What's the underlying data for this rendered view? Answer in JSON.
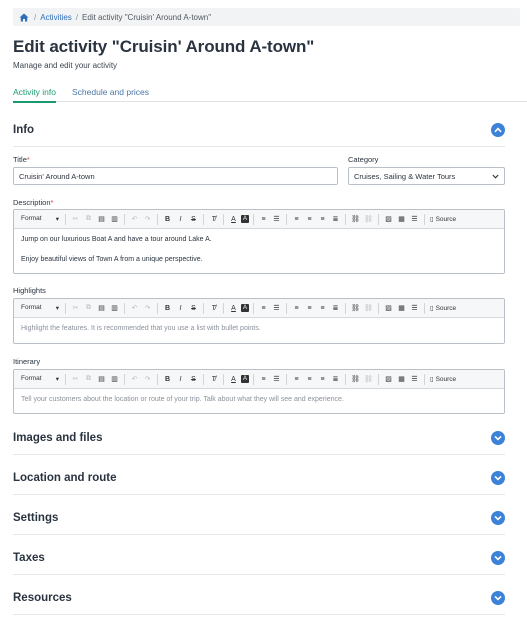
{
  "breadcrumb": {
    "activities": "Activities",
    "current": "Edit activity \"Cruisin' Around A-town\"",
    "sep": "/"
  },
  "header": {
    "title": "Edit activity \"Cruisin' Around A-town\"",
    "subtitle": "Manage and edit your activity"
  },
  "tabs": [
    {
      "label": "Activity info"
    },
    {
      "label": "Schedule and prices"
    }
  ],
  "info": {
    "heading": "Info",
    "title_label": "Title",
    "title_value": "Cruisin' Around A-town",
    "category_label": "Category",
    "category_value": "Cruises, Sailing & Water Tours",
    "description_label": "Description",
    "description_lines": [
      "Jump on our luxurious Boat A and have a tour around Lake A.",
      "Enjoy beautiful views of Town A from a unique perspective."
    ],
    "highlights_label": "Highlights",
    "highlights_placeholder": "Highlight the features. It is recommended that you use a list with bullet points.",
    "itinerary_label": "Itinerary",
    "itinerary_placeholder": "Tell your customers about the location or route of your trip. Talk about what they will see and experience.",
    "required_mark": "*"
  },
  "toolbar": {
    "format_label": "Format",
    "source_label": "Source"
  },
  "sections": [
    {
      "title": "Images and files"
    },
    {
      "title": "Location and route"
    },
    {
      "title": "Settings"
    },
    {
      "title": "Taxes"
    },
    {
      "title": "Resources"
    }
  ],
  "colors": {
    "accent_green": "#1a9a6c",
    "link_blue": "#2f6fb8",
    "chevron_blue": "#3c82d8"
  }
}
